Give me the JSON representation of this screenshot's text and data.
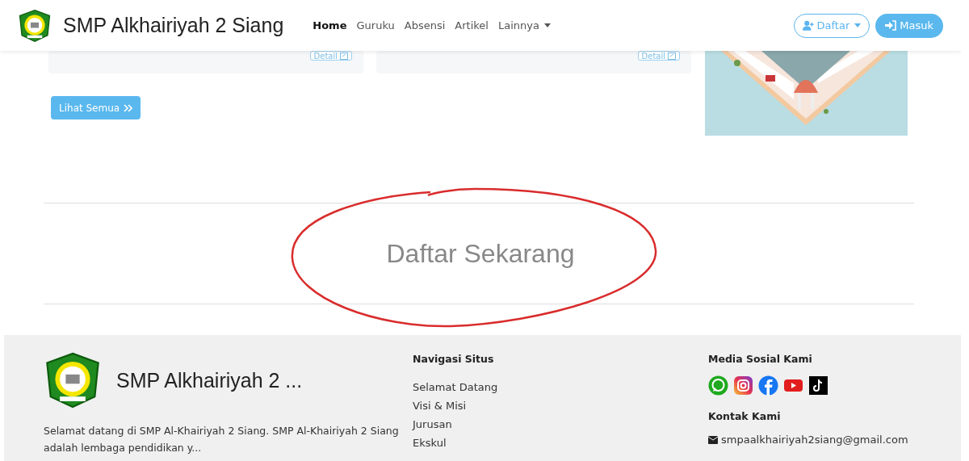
{
  "navbar": {
    "brand": "SMP Alkhairiyah 2 Siang",
    "links": [
      {
        "label": "Home",
        "selected": true
      },
      {
        "label": "Guruku",
        "selected": false
      },
      {
        "label": "Absensi",
        "selected": false
      },
      {
        "label": "Artikel",
        "selected": false
      }
    ],
    "dropdown": "Lainnya",
    "register_button": "Daftar",
    "login_button": "Masuk"
  },
  "cards": [
    {
      "button": "Detail"
    },
    {
      "button": "Detail"
    }
  ],
  "see_all_button": "Lihat Semua",
  "cta": {
    "title": "Daftar Sekarang",
    "circled": true
  },
  "footer": {
    "brand": "SMP Alkhairiyah 2 ...",
    "description": "Selamat datang di SMP Al-Khairiyah 2 Siang. SMP Al-Khairiyah 2 Siang adalah lembaga pendidikan y...",
    "nav_title": "Navigasi Situs",
    "nav_items": [
      "Selamat Datang",
      "Visi & Misi",
      "Jurusan",
      "Ekskul"
    ],
    "social_title": "Media Sosial Kami",
    "socials": [
      {
        "kind": "whatsapp"
      },
      {
        "kind": "instagram"
      },
      {
        "kind": "facebook"
      },
      {
        "kind": "youtube"
      },
      {
        "kind": "tiktok"
      }
    ],
    "contact_title": "Kontak Kami",
    "email": "smpaalkhairiyah2siang@gmail.com"
  }
}
